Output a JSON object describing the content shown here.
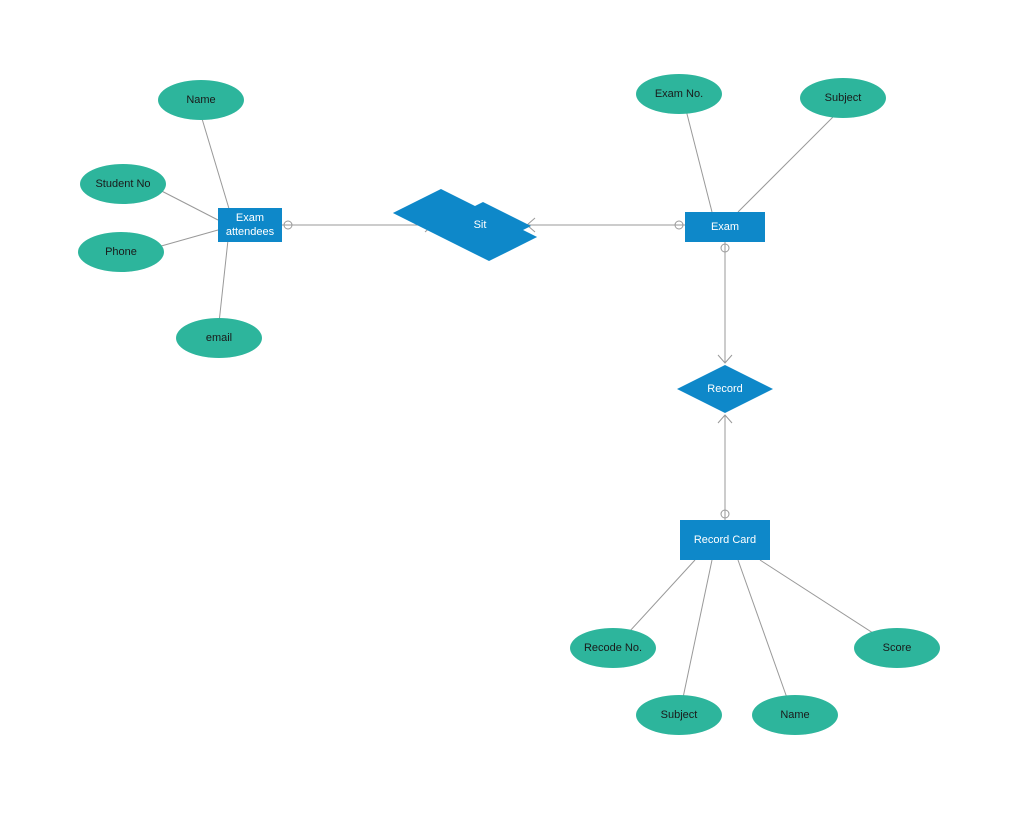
{
  "entities": {
    "examAttendees": "Exam\nattendees",
    "exam": "Exam",
    "recordCard": "Record Card"
  },
  "relationships": {
    "sit": "Sit",
    "record": "Record"
  },
  "attributes": {
    "name1": "Name",
    "studentNo": "Student No",
    "phone": "Phone",
    "email": "email",
    "examNo": "Exam No.",
    "subject1": "Subject",
    "recodeNo": "Recode No.",
    "subject2": "Subject",
    "name2": "Name",
    "score": "Score"
  }
}
